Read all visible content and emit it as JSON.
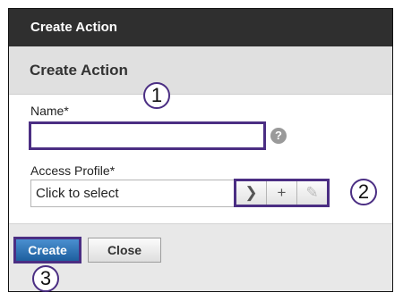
{
  "dialog": {
    "title": "Create Action",
    "subheader": "Create Action",
    "name_field": {
      "label": "Name*",
      "value": "",
      "placeholder": ""
    },
    "help_glyph": "?",
    "access_profile": {
      "label": "Access Profile*",
      "value": "Click to select",
      "select_glyph": "❯",
      "add_glyph": "+",
      "edit_glyph": "✎"
    },
    "buttons": {
      "create": "Create",
      "close": "Close"
    }
  },
  "callouts": [
    "1",
    "2",
    "3"
  ],
  "colors": {
    "titlebar": "#2f2f2f",
    "highlight": "#4b2e83",
    "primary_button": "#2a6db0"
  }
}
